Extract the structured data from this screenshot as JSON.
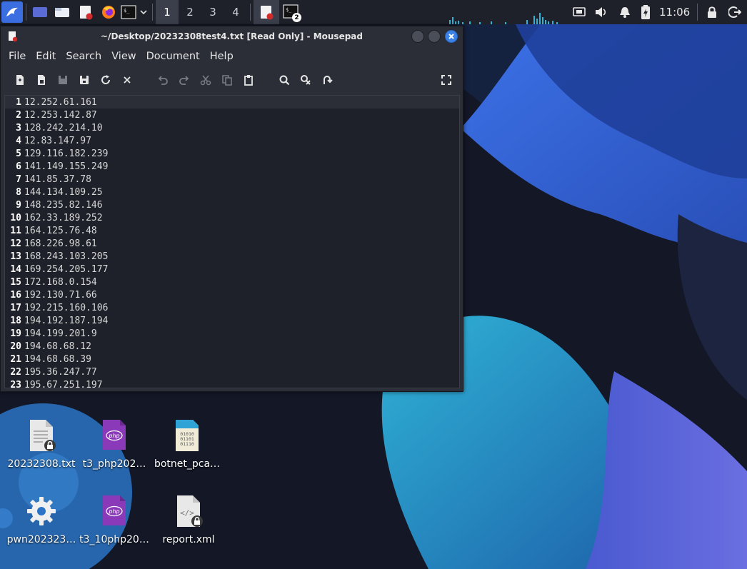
{
  "taskbar": {
    "workspaces": [
      "1",
      "2",
      "3",
      "4"
    ],
    "active_workspace": "1",
    "terminal_badge": "2",
    "clock": "11:06"
  },
  "window": {
    "title": "~/Desktop/20232308test4.txt [Read Only] - Mousepad",
    "menu": [
      "File",
      "Edit",
      "Search",
      "View",
      "Document",
      "Help"
    ],
    "toolbar": [
      "new-document-icon",
      "new-window-icon",
      "save-icon",
      "save-as-icon",
      "reload-icon",
      "close-tab-icon",
      "undo-icon",
      "redo-icon",
      "cut-icon",
      "copy-icon",
      "paste-icon",
      "find-icon",
      "find-replace-icon",
      "goto-icon",
      "fullscreen-icon"
    ],
    "lines": [
      {
        "n": "1",
        "text": "12.252.61.161"
      },
      {
        "n": "2",
        "text": "12.253.142.87"
      },
      {
        "n": "3",
        "text": "128.242.214.10"
      },
      {
        "n": "4",
        "text": "12.83.147.97"
      },
      {
        "n": "5",
        "text": "129.116.182.239"
      },
      {
        "n": "6",
        "text": "141.149.155.249"
      },
      {
        "n": "7",
        "text": "141.85.37.78"
      },
      {
        "n": "8",
        "text": "144.134.109.25"
      },
      {
        "n": "9",
        "text": "148.235.82.146"
      },
      {
        "n": "10",
        "text": "162.33.189.252"
      },
      {
        "n": "11",
        "text": "164.125.76.48"
      },
      {
        "n": "12",
        "text": "168.226.98.61"
      },
      {
        "n": "13",
        "text": "168.243.103.205"
      },
      {
        "n": "14",
        "text": "169.254.205.177"
      },
      {
        "n": "15",
        "text": "172.168.0.154"
      },
      {
        "n": "16",
        "text": "192.130.71.66"
      },
      {
        "n": "17",
        "text": "192.215.160.106"
      },
      {
        "n": "18",
        "text": "194.192.187.194"
      },
      {
        "n": "19",
        "text": "194.199.201.9"
      },
      {
        "n": "20",
        "text": "194.68.68.12"
      },
      {
        "n": "21",
        "text": "194.68.68.39"
      },
      {
        "n": "22",
        "text": "195.36.247.77"
      },
      {
        "n": "23",
        "text": "195.67.251.197"
      }
    ]
  },
  "desktop": {
    "icons": [
      {
        "label": "20232308.txt",
        "icon": "text-file-locked-icon"
      },
      {
        "label": "t3_php202…",
        "icon": "php-file-icon"
      },
      {
        "label": "botnet_pca…",
        "icon": "binary-file-icon"
      },
      {
        "label": "pwn202323…",
        "icon": "gear-icon"
      },
      {
        "label": "t3_10php20…",
        "icon": "php-file-icon"
      },
      {
        "label": "report.xml",
        "icon": "xml-file-locked-icon"
      }
    ]
  },
  "colors": {
    "accent": "#3b6ee0",
    "taskbar_bg": "#1e2129",
    "window_bg": "#2b2e36",
    "editor_bg": "#1e2129",
    "php_purple": "#8a3ab9"
  }
}
